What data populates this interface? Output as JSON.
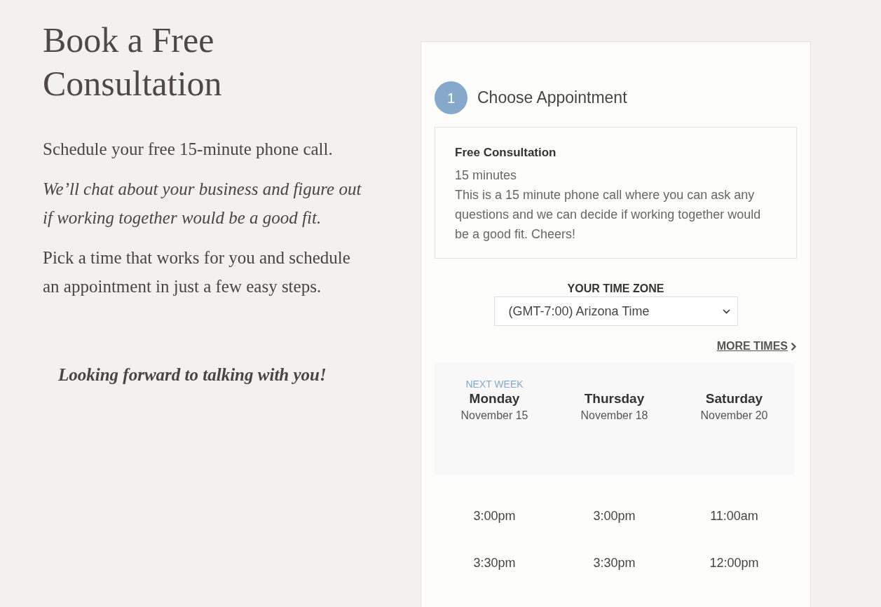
{
  "heading": "Book a Free Consultation",
  "paragraphs": [
    {
      "kind": "plain",
      "text": "Schedule your free 15-minute phone call."
    },
    {
      "kind": "italic",
      "text": "We’ll chat about your business and figure out if working together would be a good fit."
    },
    {
      "kind": "plain",
      "text": "Pick a time that works for you and schedule an appointment in just a few easy steps."
    }
  ],
  "closing": "Looking forward to talking with you!",
  "booking": {
    "step": "1",
    "step_title": "Choose Appointment",
    "appointment": {
      "name": "Free Consultation",
      "duration": "15 minutes",
      "description": "This is a 15 minute phone call where you can ask any questions and we can decide if working together would be a good fit. Cheers!"
    },
    "timezone_label": "YOUR TIME ZONE",
    "timezone": "(GMT-7:00) Arizona Time",
    "more_times": "MORE TIMES",
    "days": [
      {
        "tag": "NEXT WEEK",
        "day": "Monday",
        "date": "November 15",
        "times": [
          "3:00pm",
          "3:30pm"
        ]
      },
      {
        "day": "Thursday",
        "date": "November 18",
        "times": [
          "3:00pm",
          "3:30pm"
        ]
      },
      {
        "day": "Saturday",
        "date": "November 20",
        "times": [
          "11:00am",
          "12:00pm"
        ]
      }
    ]
  }
}
